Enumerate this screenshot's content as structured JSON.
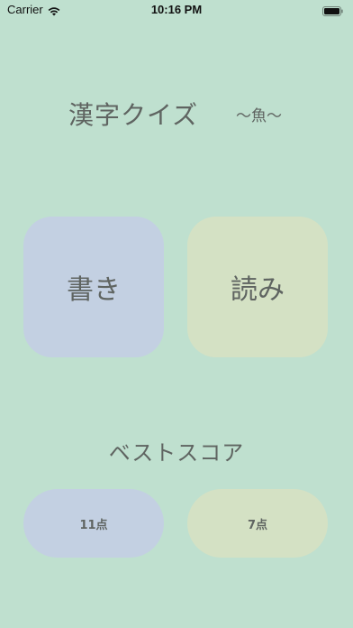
{
  "status_bar": {
    "carrier": "Carrier",
    "time": "10:16 PM",
    "wifi_icon": "wifi-icon",
    "battery_icon": "battery-icon"
  },
  "header": {
    "title": "漢字クイズ",
    "subtitle": "〜魚〜"
  },
  "modes": {
    "write_label": "書き",
    "read_label": "読み"
  },
  "best_score": {
    "heading": "ベストスコア",
    "write_score": "11点",
    "read_score": "7点"
  },
  "colors": {
    "background": "#bfe0cf",
    "write_accent": "#c3d0e2",
    "read_accent": "#d4e1c4",
    "text": "#5f6461"
  }
}
